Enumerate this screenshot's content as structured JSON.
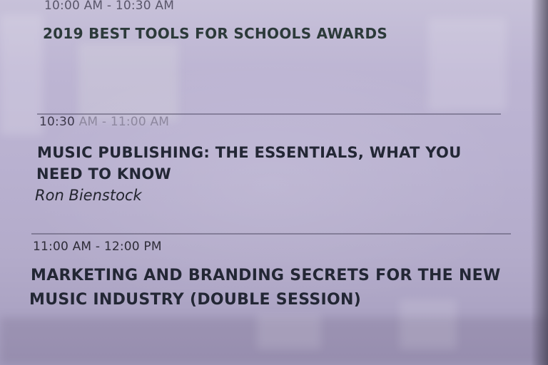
{
  "sessions": [
    {
      "time": "10:00 AM - 10:30 AM",
      "title": "2019 BEST TOOLS FOR SCHOOLS AWARDS"
    },
    {
      "time_start": "10:30",
      "time_rest": " AM - 11:00 AM",
      "title_line1": "MUSIC PUBLISHING: THE ESSENTIALS, WHAT YOU",
      "title_line2": "NEED TO KNOW",
      "speaker": "Ron Bienstock"
    },
    {
      "time": "11:00 AM - 12:00 PM",
      "title_line1": "MARKETING AND BRANDING SECRETS FOR THE NEW",
      "title_line2": "MUSIC INDUSTRY (DOUBLE SESSION)"
    }
  ]
}
